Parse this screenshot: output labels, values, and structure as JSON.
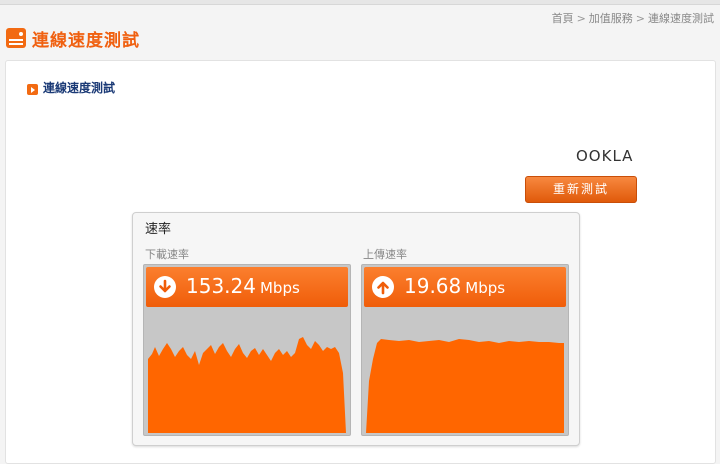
{
  "breadcrumb": {
    "home": "首頁",
    "services": "加值服務",
    "current": "連線速度測試",
    "sep": ">"
  },
  "header": {
    "title": "連線速度測試"
  },
  "section": {
    "title": "連線速度測試"
  },
  "brand": {
    "logo_text": "OOKLA"
  },
  "retest_button": {
    "label": "重新測試"
  },
  "speed": {
    "title": "速率",
    "download": {
      "label": "下載速率",
      "value": "153.24",
      "unit": "Mbps"
    },
    "upload": {
      "label": "上傳速率",
      "value": "19.68",
      "unit": "Mbps"
    }
  },
  "colors": {
    "accent": "#f26a12",
    "title_blue": "#1b3a76",
    "graph_fill": "#ff6600",
    "graph_bg": "#c7c7c7"
  }
}
